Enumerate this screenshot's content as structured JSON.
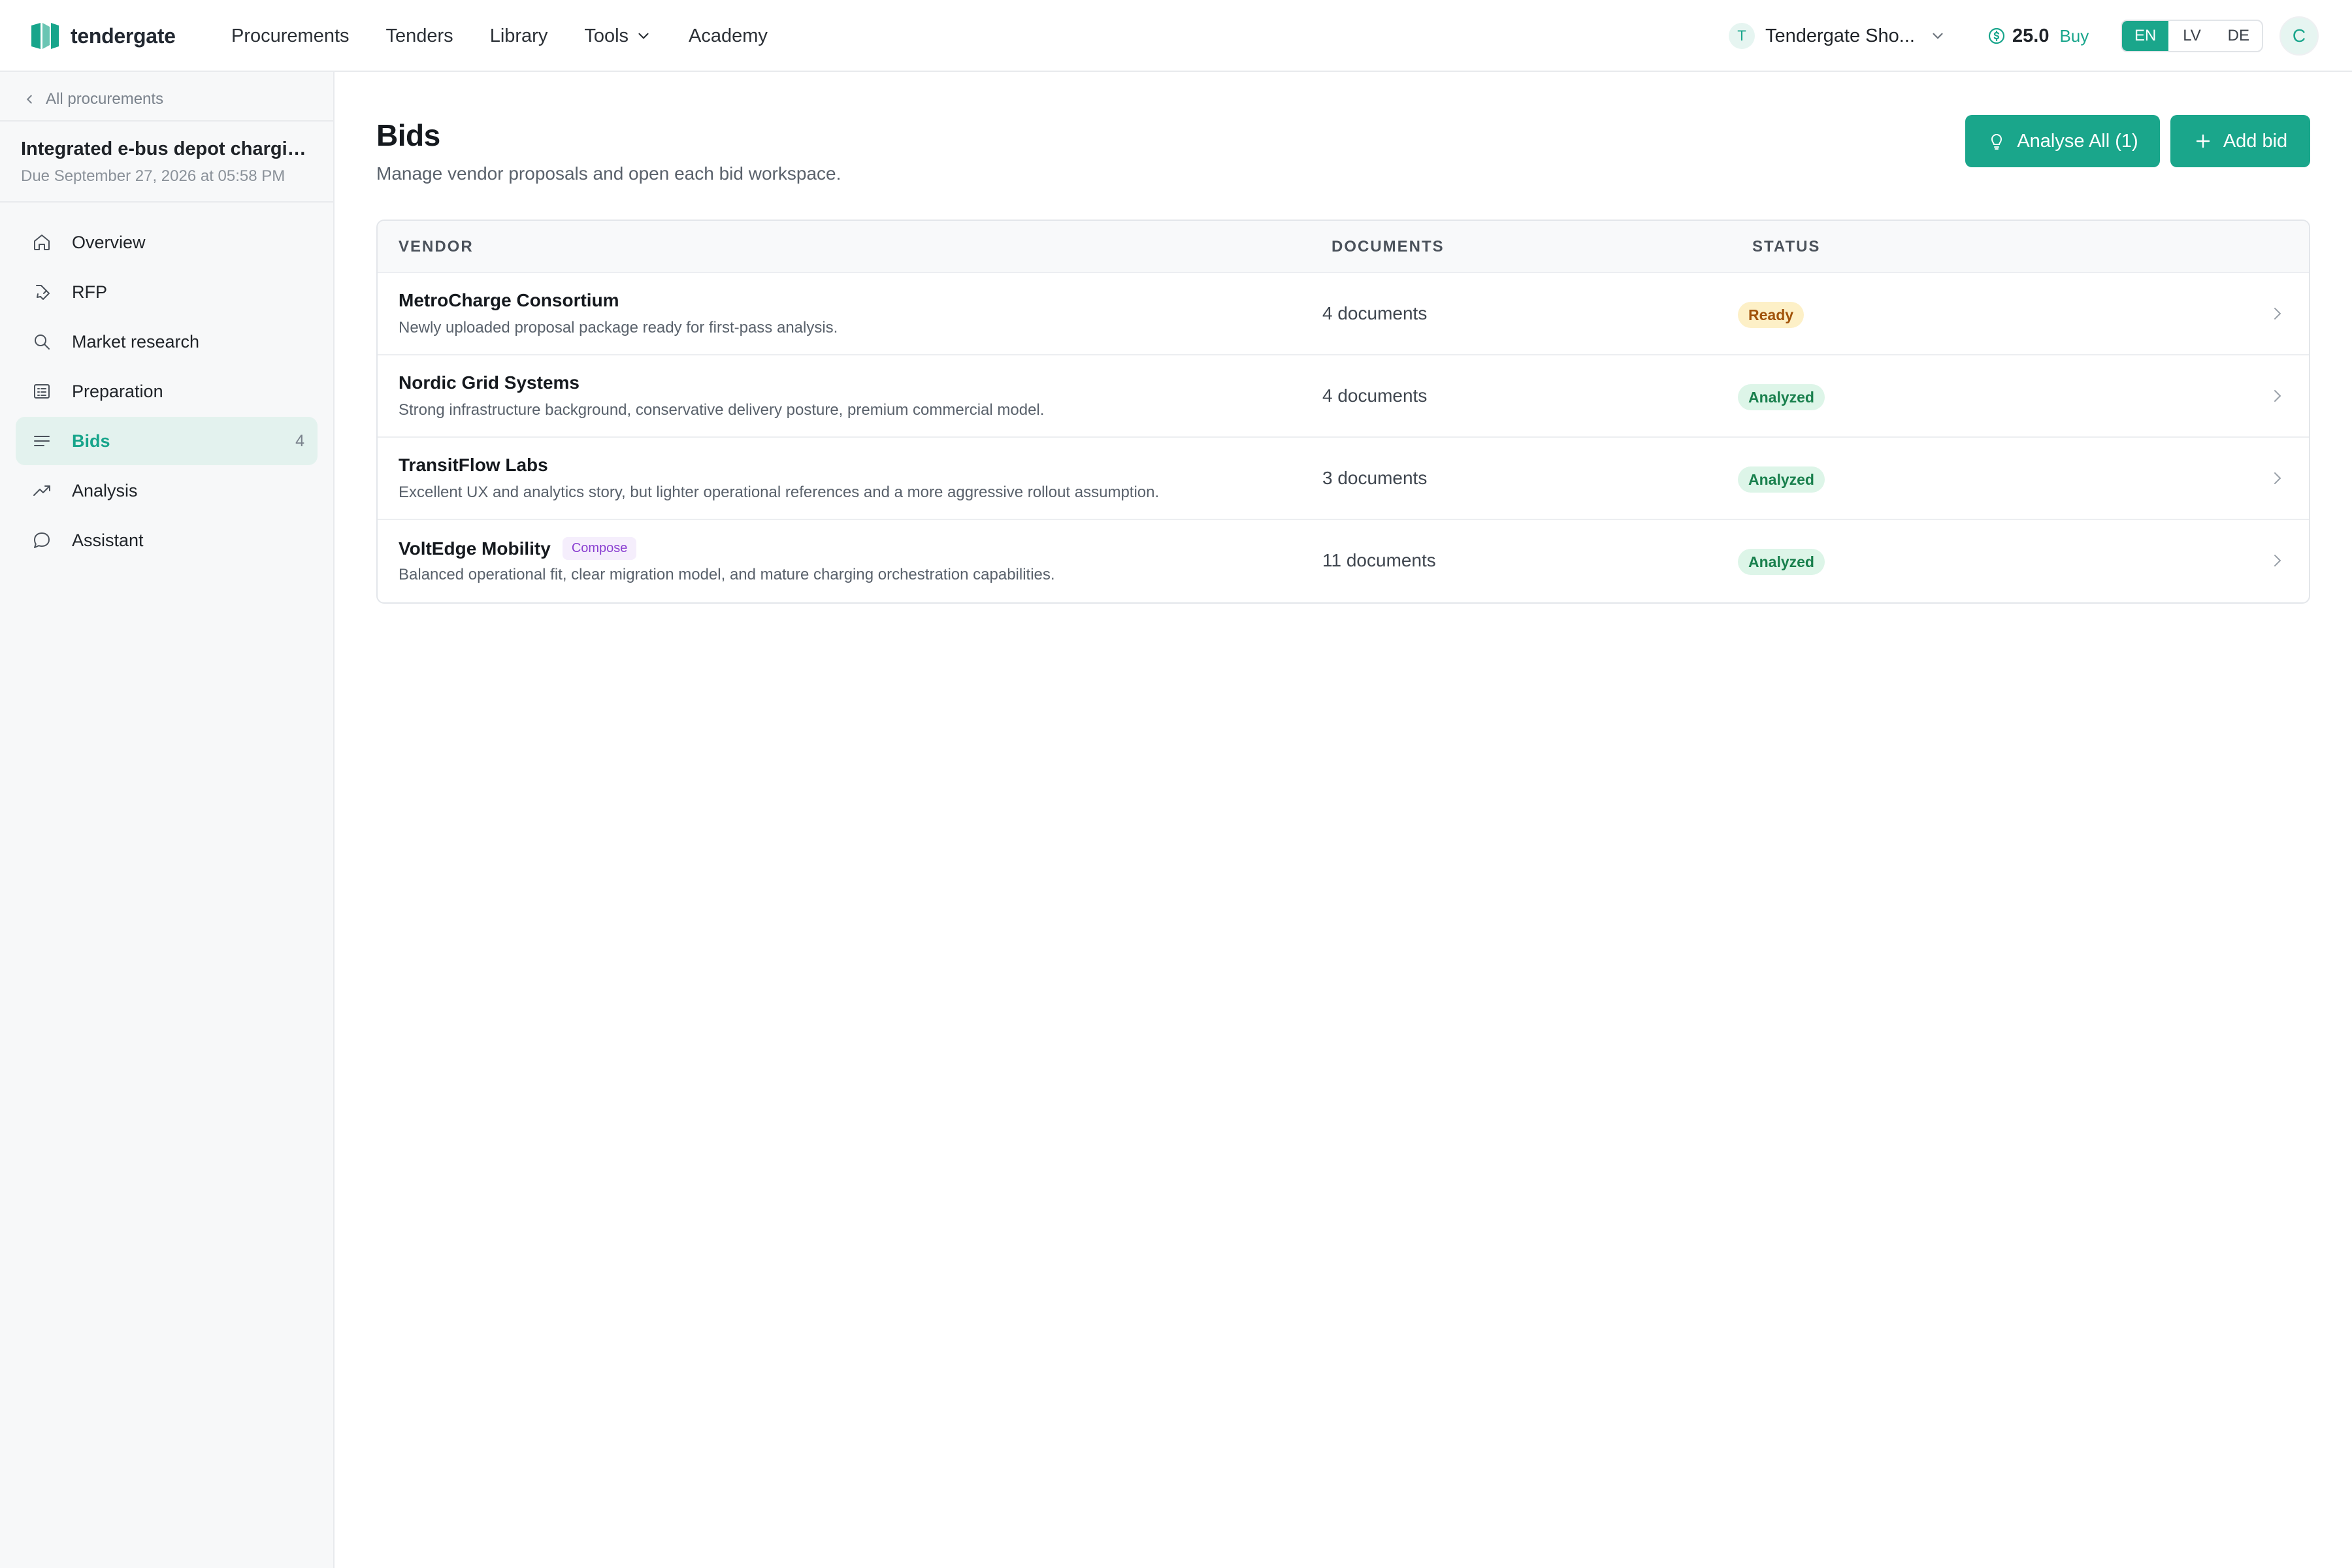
{
  "brand": {
    "name": "tendergate"
  },
  "nav": [
    {
      "label": "Procurements"
    },
    {
      "label": "Tenders"
    },
    {
      "label": "Library"
    },
    {
      "label": "Tools"
    },
    {
      "label": "Academy"
    }
  ],
  "workspace": {
    "initial": "T",
    "name": "Tendergate Sho..."
  },
  "credits": {
    "value": "25.0",
    "buy_label": "Buy"
  },
  "languages": [
    {
      "code": "EN",
      "active": true
    },
    {
      "code": "LV",
      "active": false
    },
    {
      "code": "DE",
      "active": false
    }
  ],
  "user": {
    "initial": "C"
  },
  "sidebar": {
    "back_label": "All procurements",
    "procurement_title": "Integrated e-bus depot charging...",
    "procurement_due": "Due September 27, 2026 at 05:58 PM",
    "items": [
      {
        "label": "Overview",
        "icon": "home-icon"
      },
      {
        "label": "RFP",
        "icon": "pen-icon"
      },
      {
        "label": "Market research",
        "icon": "search-icon"
      },
      {
        "label": "Preparation",
        "icon": "checklist-icon"
      },
      {
        "label": "Bids",
        "icon": "list-icon",
        "count": "4",
        "active": true
      },
      {
        "label": "Analysis",
        "icon": "trend-icon"
      },
      {
        "label": "Assistant",
        "icon": "chat-icon"
      }
    ]
  },
  "page": {
    "title": "Bids",
    "subtitle": "Manage vendor proposals and open each bid workspace.",
    "analyse_all_label": "Analyse All (1)",
    "add_bid_label": "Add bid"
  },
  "table": {
    "headers": {
      "vendor": "VENDOR",
      "documents": "DOCUMENTS",
      "status": "STATUS"
    },
    "rows": [
      {
        "vendor": "MetroCharge Consortium",
        "tag": "",
        "description": "Newly uploaded proposal package ready for first-pass analysis.",
        "documents": "4 documents",
        "status": "Ready"
      },
      {
        "vendor": "Nordic Grid Systems",
        "tag": "",
        "description": "Strong infrastructure background, conservative delivery posture, premium commercial model.",
        "documents": "4 documents",
        "status": "Analyzed"
      },
      {
        "vendor": "TransitFlow Labs",
        "tag": "",
        "description": "Excellent UX and analytics story, but lighter operational references and a more aggressive rollout assumption.",
        "documents": "3 documents",
        "status": "Analyzed"
      },
      {
        "vendor": "VoltEdge Mobility",
        "tag": "Compose",
        "description": "Balanced operational fit, clear migration model, and mature charging orchestration capabilities.",
        "documents": "11 documents",
        "status": "Analyzed"
      }
    ]
  },
  "colors": {
    "accent": "#1aa68b",
    "ready_bg": "#fdf0c7",
    "analyzed_bg": "#ddf5e8",
    "compose_tag": "#8a3fd1"
  }
}
